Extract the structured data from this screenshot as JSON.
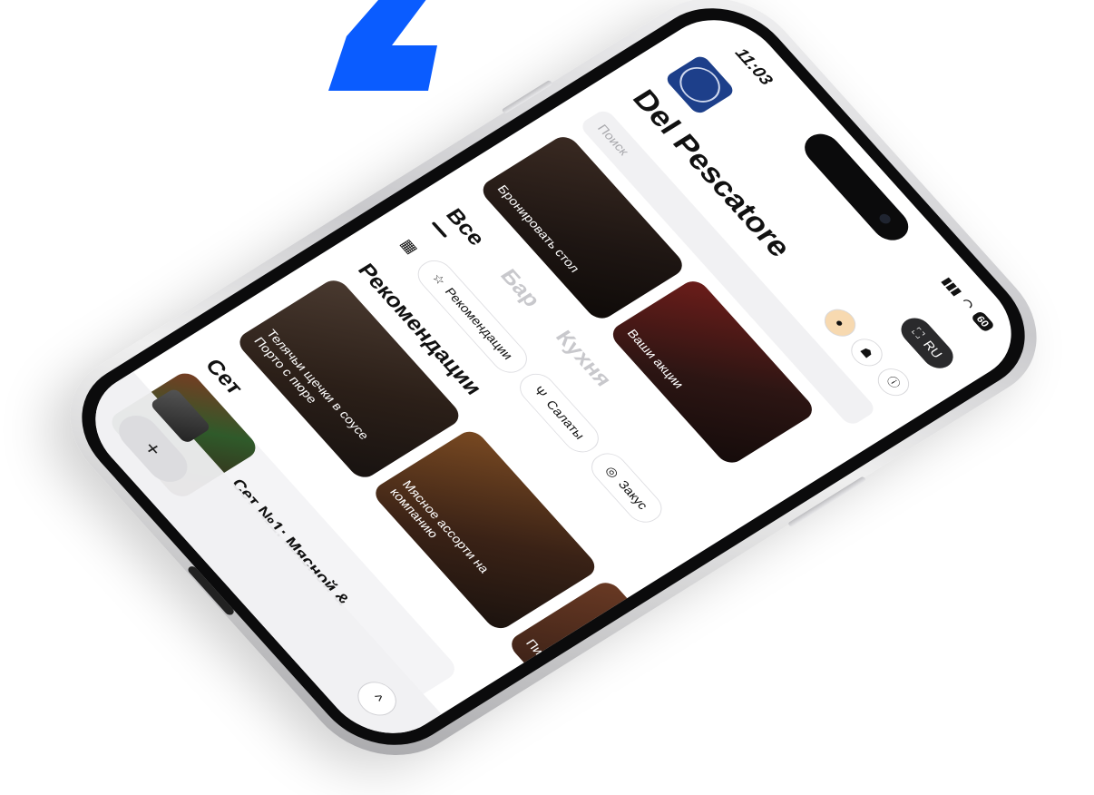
{
  "status": {
    "time": "11:03",
    "battery": "60"
  },
  "header": {
    "title": "Del Pescatore",
    "lang": "RU"
  },
  "search": {
    "placeholder": "Поиск"
  },
  "promos": [
    {
      "label": "Бронировать стол"
    },
    {
      "label": "Ваши акции"
    }
  ],
  "tabs": [
    {
      "label": "Все"
    },
    {
      "label": "Бар"
    },
    {
      "label": "Кухня"
    }
  ],
  "chips": [
    {
      "label": "Рекомендации",
      "icon": "star-icon"
    },
    {
      "label": "Салаты",
      "icon": "cutlery-icon"
    },
    {
      "label": "Закус",
      "icon": "plate-icon"
    }
  ],
  "sections": {
    "recommendations": "Рекомендации",
    "set": "Сет"
  },
  "recommendations": [
    {
      "label": "Телячьи щечки в соусе Порто с пюре"
    },
    {
      "label": "Мясное ассорти на компанию"
    },
    {
      "label": "Пи"
    }
  ],
  "set_items": [
    {
      "label": "Сет №1: Мясной &"
    }
  ],
  "bottom": {
    "add": "+",
    "up": "^"
  },
  "colors": {
    "brand_blue": "#0a5cff",
    "dark": "#111111",
    "chip_border": "#dedee2"
  }
}
